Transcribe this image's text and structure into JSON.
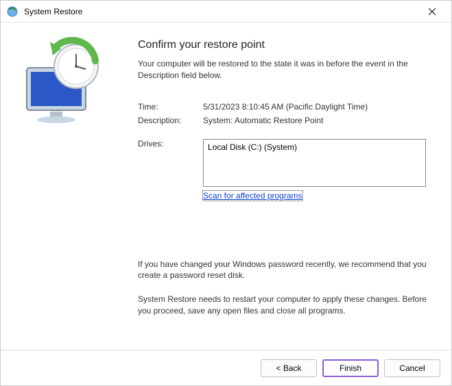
{
  "window": {
    "title": "System Restore"
  },
  "main": {
    "heading": "Confirm your restore point",
    "intro": "Your computer will be restored to the state it was in before the event in the Description field below.",
    "timeLabel": "Time:",
    "timeValue": "5/31/2023 8:10:45 AM (Pacific Daylight Time)",
    "descLabel": "Description:",
    "descValue": "System: Automatic Restore Point",
    "drivesLabel": "Drives:",
    "drivesValue": "Local Disk (C:) (System)",
    "scanLink": "Scan for affected programs",
    "warning1": "If you have changed your Windows password recently, we recommend that you create a password reset disk.",
    "warning2": "System Restore needs to restart your computer to apply these changes. Before you proceed, save any open files and close all programs."
  },
  "footer": {
    "back": "< Back",
    "finish": "Finish",
    "cancel": "Cancel"
  }
}
